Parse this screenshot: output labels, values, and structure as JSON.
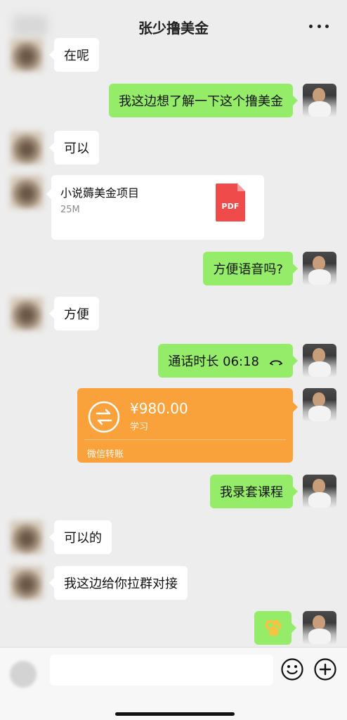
{
  "header": {
    "title": "张少撸美金"
  },
  "messages": [
    {
      "text": "在呢"
    },
    {
      "text": "我这边想了解一下这个撸美金"
    },
    {
      "text": "可以"
    },
    {
      "file": {
        "name": "小说薅美金项目",
        "size": "25M",
        "type_label": "PDF"
      }
    },
    {
      "text": "方便语音吗?"
    },
    {
      "text": "方便"
    },
    {
      "text": "通话时长 06:18"
    },
    {
      "transfer": {
        "amount": "¥980.00",
        "note": "学习",
        "brand": "微信转账"
      }
    },
    {
      "text": "我录套课程"
    },
    {
      "text": "可以的"
    },
    {
      "text": "我这边给你拉群对接"
    },
    {
      "emoji": {
        "name": "ok-hand-emoji"
      }
    }
  ],
  "footer": {
    "input_value": "",
    "input_placeholder": ""
  },
  "colors": {
    "background": "#ededed",
    "incoming_bubble": "#ffffff",
    "outgoing_bubble": "#95ec69",
    "transfer_card": "#f9a23c",
    "pdf_icon": "#ef4b4b"
  },
  "icons": {
    "more": "more-icon",
    "call": "phone-call-icon",
    "transfer": "transfer-icon",
    "pdf": "pdf-icon",
    "emoji": "smiley-icon",
    "plus": "plus-icon"
  }
}
